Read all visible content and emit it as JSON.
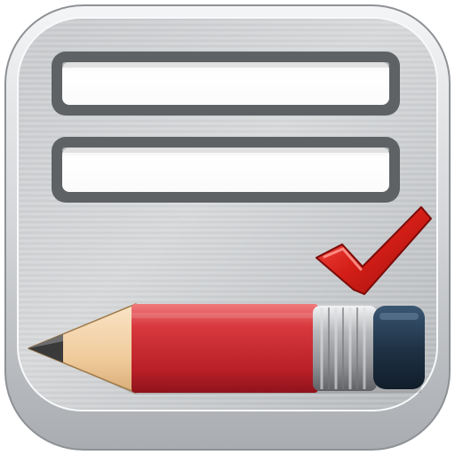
{
  "app_icon": {
    "name": "form-checklist-app-icon",
    "form_fields": [
      {
        "label": "",
        "value": ""
      },
      {
        "label": "",
        "value": ""
      }
    ],
    "check_mark": {
      "color": "#cc1f1a",
      "icon": "check-mark-icon"
    },
    "pencil": {
      "body_color": "#d2343a",
      "eraser_color": "#1f3347",
      "ferrule_color": "#a9abb0",
      "wood_color": "#f2d2a6",
      "lead_color": "#3a3a3a",
      "icon": "pencil-icon"
    },
    "frame_color": "#c2c4c7",
    "panel_color": "#bfc2c5"
  }
}
